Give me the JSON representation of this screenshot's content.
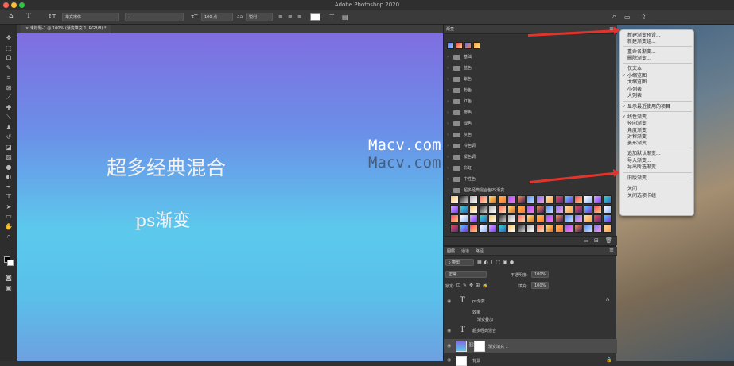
{
  "window": {
    "title": "Adobe Photoshop 2020"
  },
  "options": {
    "font_family": "华文宋体",
    "font_style": "-",
    "font_size": "100 点",
    "anti_alias": "锐利"
  },
  "document_tab": {
    "label": "未标题-1 @ 100% (渐变填充 1, RGB/8) *"
  },
  "canvas": {
    "line1": "超多经典混合",
    "line2": "ps渐变"
  },
  "watermark": {
    "text": "Macv.com"
  },
  "gradients_panel": {
    "tab": "渐变",
    "groups": [
      {
        "label": "基础"
      },
      {
        "label": "蓝色"
      },
      {
        "label": "紫色"
      },
      {
        "label": "粉色"
      },
      {
        "label": "红色"
      },
      {
        "label": "橙色"
      },
      {
        "label": "绿色"
      },
      {
        "label": "灰色"
      },
      {
        "label": "冷色调"
      },
      {
        "label": "暖色调"
      },
      {
        "label": "彩虹"
      },
      {
        "label": "中性色"
      },
      {
        "label": "超多经典混合色PS渐变"
      }
    ]
  },
  "layers_panel": {
    "tabs": [
      "图层",
      "通道",
      "路径"
    ],
    "kind": "类型",
    "blend_mode": "正常",
    "opacity_label": "不透明度:",
    "opacity": "100%",
    "lock_label": "锁定:",
    "fill_label": "填充:",
    "fill": "100%",
    "layers": [
      {
        "name": "ps渐变",
        "sub": [
          "效果",
          "渐变叠加"
        ]
      },
      {
        "name": "超多经典混合"
      },
      {
        "name": "渐变填充 1"
      },
      {
        "name": "背景"
      }
    ],
    "fx": "fx"
  },
  "flyout_menu": {
    "items": [
      {
        "label": "新建渐变预设...",
        "checked": false
      },
      {
        "label": "新建渐变组...",
        "checked": false
      },
      {
        "label": "重命名渐变...",
        "checked": false
      },
      {
        "label": "删除渐变...",
        "checked": false
      },
      {
        "label": "仅文本",
        "checked": false
      },
      {
        "label": "小缩览图",
        "checked": true
      },
      {
        "label": "大缩览图",
        "checked": false
      },
      {
        "label": "小列表",
        "checked": false
      },
      {
        "label": "大列表",
        "checked": false
      },
      {
        "label": "显示最近使用的项目",
        "checked": true
      },
      {
        "label": "线性渐变",
        "checked": true
      },
      {
        "label": "径向渐变",
        "checked": false
      },
      {
        "label": "角度渐变",
        "checked": false
      },
      {
        "label": "对称渐变",
        "checked": false
      },
      {
        "label": "菱形渐变",
        "checked": false
      },
      {
        "label": "追加默认渐变...",
        "checked": false
      },
      {
        "label": "导入渐变...",
        "checked": false
      },
      {
        "label": "导出所选渐变...",
        "checked": false
      },
      {
        "label": "旧版渐变",
        "checked": false
      },
      {
        "label": "关闭",
        "checked": false
      },
      {
        "label": "关闭选项卡组",
        "checked": false
      }
    ]
  },
  "colors": {
    "accent_arrow": "#e0342c",
    "menu_bg": "#e8e8e8",
    "canvas_top": "#7f6ee0",
    "canvas_mid": "#5cc9ec"
  }
}
